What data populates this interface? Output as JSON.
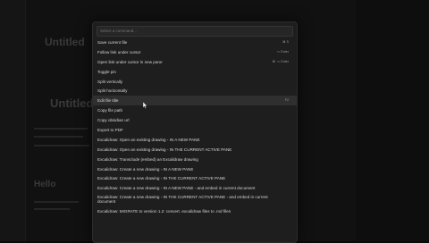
{
  "background": {
    "title_ghost_1": "Untitled",
    "title_ghost_2": "Untitled",
    "hello_ghost": "Hello"
  },
  "palette": {
    "search_placeholder": "Select a command...",
    "commands": [
      {
        "label": "Save current file",
        "hotkey": "⌘ S"
      },
      {
        "label": "Follow link under cursor",
        "hotkey": "⌥ Enter"
      },
      {
        "label": "Open link under cursor in new pane",
        "hotkey": "⌘ ⌥ Enter"
      },
      {
        "label": "Toggle pin",
        "hotkey": ""
      },
      {
        "label": "Split vertically",
        "hotkey": ""
      },
      {
        "label": "Split horizontally",
        "hotkey": ""
      },
      {
        "label": "Edit file title",
        "hotkey": "F2"
      },
      {
        "label": "Copy file path",
        "hotkey": ""
      },
      {
        "label": "Copy obsidian url",
        "hotkey": ""
      },
      {
        "label": "Export to PDF",
        "hotkey": ""
      },
      {
        "label": "Excalidraw: Open an existing drawing - IN A NEW PANE",
        "hotkey": ""
      },
      {
        "label": "Excalidraw: Open an existing drawing - IN THE CURRENT ACTIVE PANE",
        "hotkey": ""
      },
      {
        "label": "Excalidraw: Transclude (embed) an Excalidraw drawing",
        "hotkey": ""
      },
      {
        "label": "Excalidraw: Create a new drawing - IN A NEW PANE",
        "hotkey": ""
      },
      {
        "label": "Excalidraw: Create a new drawing - IN THE CURRENT ACTIVE PANE",
        "hotkey": ""
      },
      {
        "label": "Excalidraw: Create a new drawing - IN A NEW PANE - and embed in current document",
        "hotkey": ""
      },
      {
        "label": "Excalidraw: Create a new drawing - IN THE CURRENT ACTIVE PANE - and embed in current document",
        "hotkey": ""
      },
      {
        "label": "Excalidraw: MIGRATE to version 1.2: convert .excalidraw files to .md files",
        "hotkey": ""
      }
    ],
    "selected_index": 6
  }
}
